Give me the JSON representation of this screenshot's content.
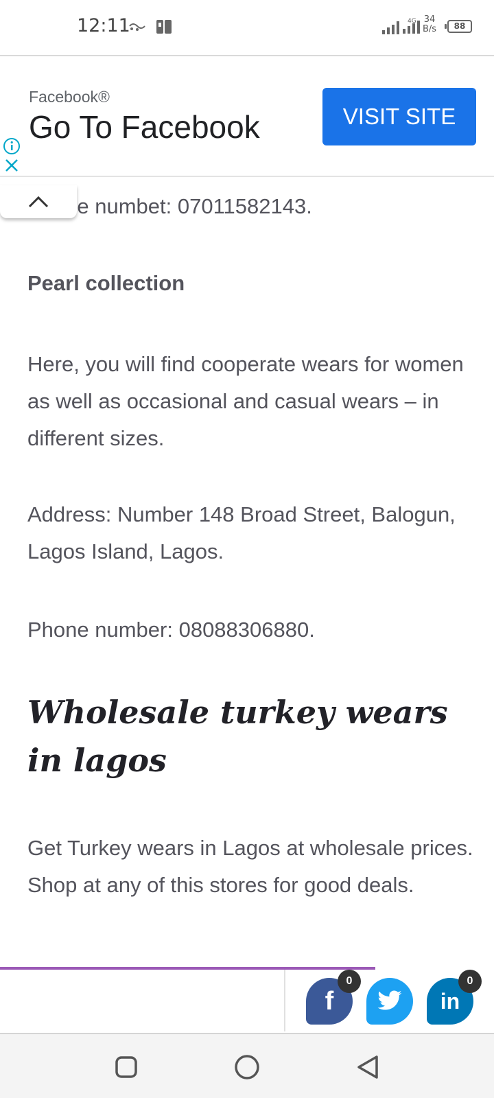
{
  "status_bar": {
    "time": "12:11",
    "network_type": "4G",
    "speed_value": "34",
    "speed_unit": "B/s",
    "battery": "88"
  },
  "ad": {
    "advertiser": "Facebook®",
    "headline": "Go To Facebook",
    "cta_label": "VISIT SITE"
  },
  "article": {
    "prev_phone_line": "Phone numbet: 07011582143.",
    "store_name": "Pearl collection",
    "store_description": "Here, you will find cooperate wears for women as well as occasional and casual wears – in different sizes.",
    "store_address": "Address: Number 148 Broad Street, Balogun, Lagos Island, Lagos.",
    "store_phone": "Phone number: 08088306880.",
    "section_heading": "Wholesale turkey wears in lagos",
    "section_intro": "Get Turkey wears in Lagos at wholesale prices. Shop at any of this stores for good deals."
  },
  "reading_progress": 0.76,
  "share": {
    "facebook_count": "0",
    "linkedin_count": "0",
    "facebook_glyph": "f",
    "linkedin_glyph": "in"
  },
  "colors": {
    "accent_button": "#1a73e8",
    "progress": "#9b59b6",
    "facebook": "#3b5998",
    "twitter": "#1da1f2",
    "linkedin": "#0077b5"
  },
  "icons": {
    "ad_info": "info-icon",
    "ad_close": "close-icon",
    "collapse": "chevron-up-icon",
    "nav_recents": "square-icon",
    "nav_home": "circle-icon",
    "nav_back": "triangle-back-icon"
  }
}
